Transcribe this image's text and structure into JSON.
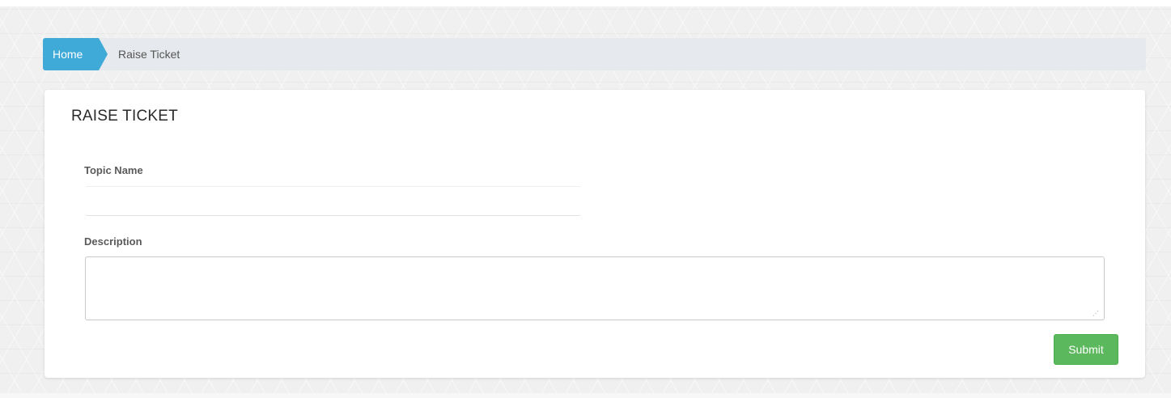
{
  "breadcrumb": {
    "home_label": "Home",
    "current_label": "Raise Ticket"
  },
  "form": {
    "title": "RAISE TICKET",
    "topic_label": "Topic Name",
    "topic_value": "",
    "description_label": "Description",
    "description_value": "",
    "submit_label": "Submit"
  },
  "icons": {
    "resize_grip": "resize-grip-icon"
  },
  "colors": {
    "breadcrumb_active": "#3fa9d8",
    "breadcrumb_bg": "#e6e9ed",
    "submit": "#5cb85c"
  }
}
